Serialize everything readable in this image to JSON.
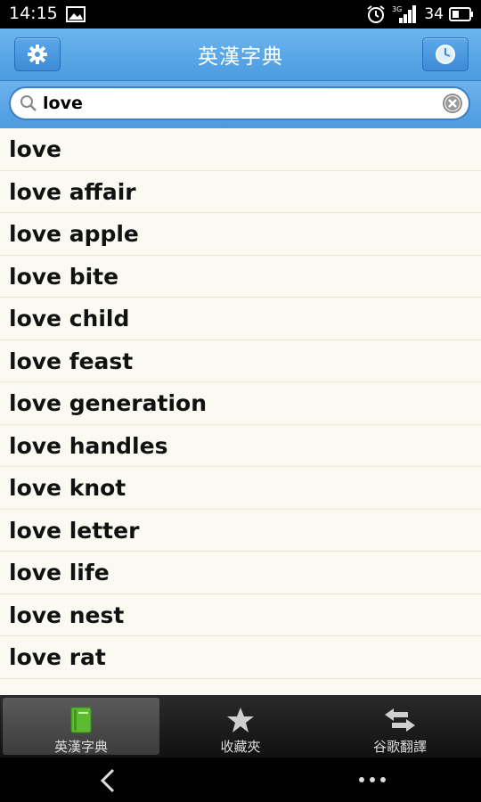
{
  "status": {
    "time": "14:15",
    "battery": "34",
    "network": "3G"
  },
  "header": {
    "title": "英漢字典"
  },
  "search": {
    "value": "love"
  },
  "results": [
    "love",
    "love affair",
    "love apple",
    "love bite",
    "love child",
    "love feast",
    "love generation",
    "love handles",
    "love knot",
    "love letter",
    "love life",
    "love nest",
    "love rat"
  ],
  "tabs": [
    {
      "label": "英漢字典",
      "icon": "book-icon",
      "active": true
    },
    {
      "label": "收藏夾",
      "icon": "star-icon",
      "active": false
    },
    {
      "label": "谷歌翻譯",
      "icon": "swap-arrows-icon",
      "active": false
    }
  ],
  "colors": {
    "header": "#4b9be0",
    "list_bg": "#fafaf2",
    "tab_active": "#4a4a4a",
    "book_green": "#5dbb2f"
  }
}
